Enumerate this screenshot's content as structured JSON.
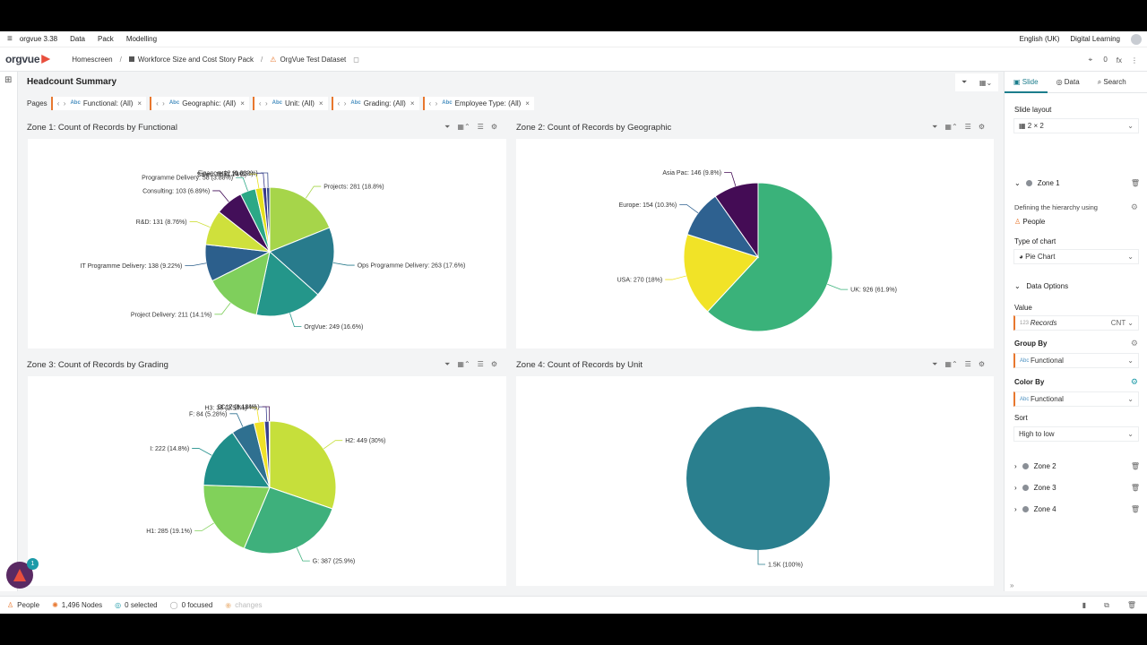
{
  "menubar": {
    "app": "orgvue 3.38",
    "items": [
      "Data",
      "Pack",
      "Modelling"
    ],
    "language": "English (UK)",
    "user": "Digital Learning"
  },
  "breadcrumb": {
    "logo": "orgvue",
    "home": "Homescreen",
    "pack": "Workforce Size and Cost Story Pack",
    "dataset": "OrgVue Test Dataset",
    "counter": "0",
    "fx": "fx"
  },
  "slide": {
    "title": "Headcount Summary",
    "pages_label": "Pages",
    "filters": [
      "Functional: (All)",
      "Geographic: (All)",
      "Unit: (All)",
      "Grading: (All)",
      "Employee Type: (All)"
    ]
  },
  "zones": [
    {
      "title": "Zone 1: Count of Records by Functional",
      "chart_data": {
        "type": "pie",
        "categories": [
          "Projects",
          "Ops Programme Delivery",
          "OrgVue",
          "Project Delivery",
          "IT Programme Delivery",
          "R&D",
          "Consulting",
          "Programme Delivery",
          "Sales",
          "HR",
          "Finance"
        ],
        "values": [
          281,
          263,
          249,
          211,
          138,
          131,
          103,
          58,
          26,
          15,
          12
        ],
        "labels": [
          "Projects: 281 (18.8%)",
          "Ops Programme Delivery: 263 (17.6%)",
          "OrgVue: 249 (16.6%)",
          "Project Delivery: 211 (14.1%)",
          "IT Programme Delivery: 138 (9.22%)",
          "R&D: 131 (8.76%)",
          "Consulting: 103 (6.89%)",
          "Programme Delivery: 58 (3.88%)",
          "Sales: 26 (1.74%)",
          "HR: 15 (1%)",
          "Finance: 12 (0.802%)"
        ],
        "colors": [
          "#a6d54a",
          "#287b8c",
          "#24968a",
          "#7fcf5c",
          "#2c5f8c",
          "#cfe03c",
          "#430f59",
          "#2ca886",
          "#e6e11c",
          "#3a3a8a",
          "#3b4f8c"
        ]
      }
    },
    {
      "title": "Zone 2: Count of Records by Geographic",
      "chart_data": {
        "type": "pie",
        "categories": [
          "UK",
          "USA",
          "Europe",
          "Asia Pac"
        ],
        "values": [
          926,
          270,
          154,
          146
        ],
        "labels": [
          "UK: 926 (61.9%)",
          "USA: 270 (18%)",
          "Europe: 154 (10.3%)",
          "Asia Pac: 146 (9.8%)"
        ],
        "colors": [
          "#3ab27a",
          "#f1e327",
          "#2e6190",
          "#440c55"
        ]
      }
    },
    {
      "title": "Zone 3: Count of Records by Grading",
      "chart_data": {
        "type": "pie",
        "categories": [
          "H2",
          "G",
          "H1",
          "I",
          "F",
          "H3",
          "D",
          "C"
        ],
        "values": [
          449,
          387,
          285,
          222,
          84,
          38,
          17,
          2
        ],
        "labels": [
          "H2: 449 (30%)",
          "G: 387 (25.9%)",
          "H1: 285 (19.1%)",
          "I: 222 (14.8%)",
          "F: 84 (5.28%)",
          "H3: 38 (2.54%)",
          "D: 17 (1.14%)",
          "C: 2 (0.134%)"
        ],
        "colors": [
          "#c6df3b",
          "#3eb07c",
          "#81d15a",
          "#1f8e8a",
          "#2f7090",
          "#f0e229",
          "#3a3f8e",
          "#4b1a5e"
        ]
      }
    },
    {
      "title": "Zone 4: Count of Records by Unit",
      "chart_data": {
        "type": "pie",
        "categories": [
          "1.5K"
        ],
        "values": [
          1496
        ],
        "labels": [
          "1.5K (100%)"
        ],
        "colors": [
          "#2a7f8e"
        ]
      }
    }
  ],
  "panel": {
    "tabs": [
      "Slide",
      "Data",
      "Search"
    ],
    "slide_layout_label": "Slide layout",
    "slide_layout_value": "2 × 2",
    "zone1": "Zone 1",
    "hierarchy_label": "Defining the hierarchy using",
    "hierarchy_value": "People",
    "chart_type_label": "Type of chart",
    "chart_type_value": "Pie Chart",
    "data_options": "Data Options",
    "value_label": "Value",
    "value_field": "Records",
    "value_agg": "CNT",
    "group_by_label": "Group By",
    "group_by_value": "Functional",
    "color_by_label": "Color By",
    "color_by_value": "Functional",
    "sort_label": "Sort",
    "sort_value": "High to low",
    "zone2": "Zone 2",
    "zone3": "Zone 3",
    "zone4": "Zone 4"
  },
  "status": {
    "people": "People",
    "nodes": "1,496 Nodes",
    "selected": "0 selected",
    "focused": "0 focused",
    "changes": "changes",
    "help_badge": "1"
  }
}
